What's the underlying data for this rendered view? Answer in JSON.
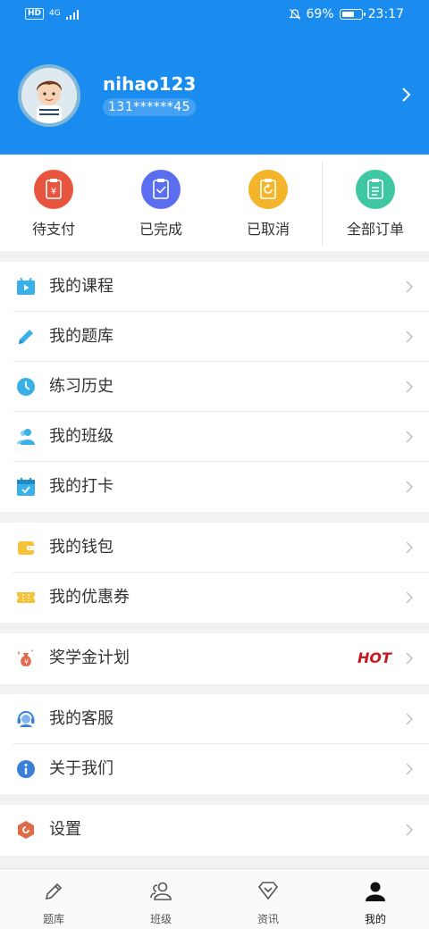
{
  "status_bar": {
    "network": "4G",
    "hd": "HD",
    "battery": "69%",
    "battery_level": 0.69,
    "time": "23:17"
  },
  "profile": {
    "username": "nihao123",
    "phone": "131******45"
  },
  "orders": [
    {
      "label": "待支付",
      "icon": "yuan-clipboard-icon",
      "color": "#e8553f"
    },
    {
      "label": "已完成",
      "icon": "check-clipboard-icon",
      "color": "#5b6ef0"
    },
    {
      "label": "已取消",
      "icon": "refresh-clipboard-icon",
      "color": "#f5b52a"
    },
    {
      "label": "全部订单",
      "icon": "list-clipboard-icon",
      "color": "#3ec7a0"
    }
  ],
  "menu": {
    "courses": "我的课程",
    "questions": "我的题库",
    "history": "练习历史",
    "classes": "我的班级",
    "checkin": "我的打卡",
    "wallet": "我的钱包",
    "coupons": "我的优惠券",
    "scholarship": "奖学金计划",
    "hot_badge": "HOT",
    "service": "我的客服",
    "about": "关于我们",
    "settings": "设置"
  },
  "tabs": [
    {
      "label": "题库",
      "icon": "pencil-icon"
    },
    {
      "label": "班级",
      "icon": "people-icon"
    },
    {
      "label": "资讯",
      "icon": "diamond-icon"
    },
    {
      "label": "我的",
      "icon": "person-icon",
      "active": true
    }
  ],
  "colors": {
    "header": "#1a8cf0",
    "hot": "#c8171e",
    "icon_blue": "#3ab0e8"
  }
}
